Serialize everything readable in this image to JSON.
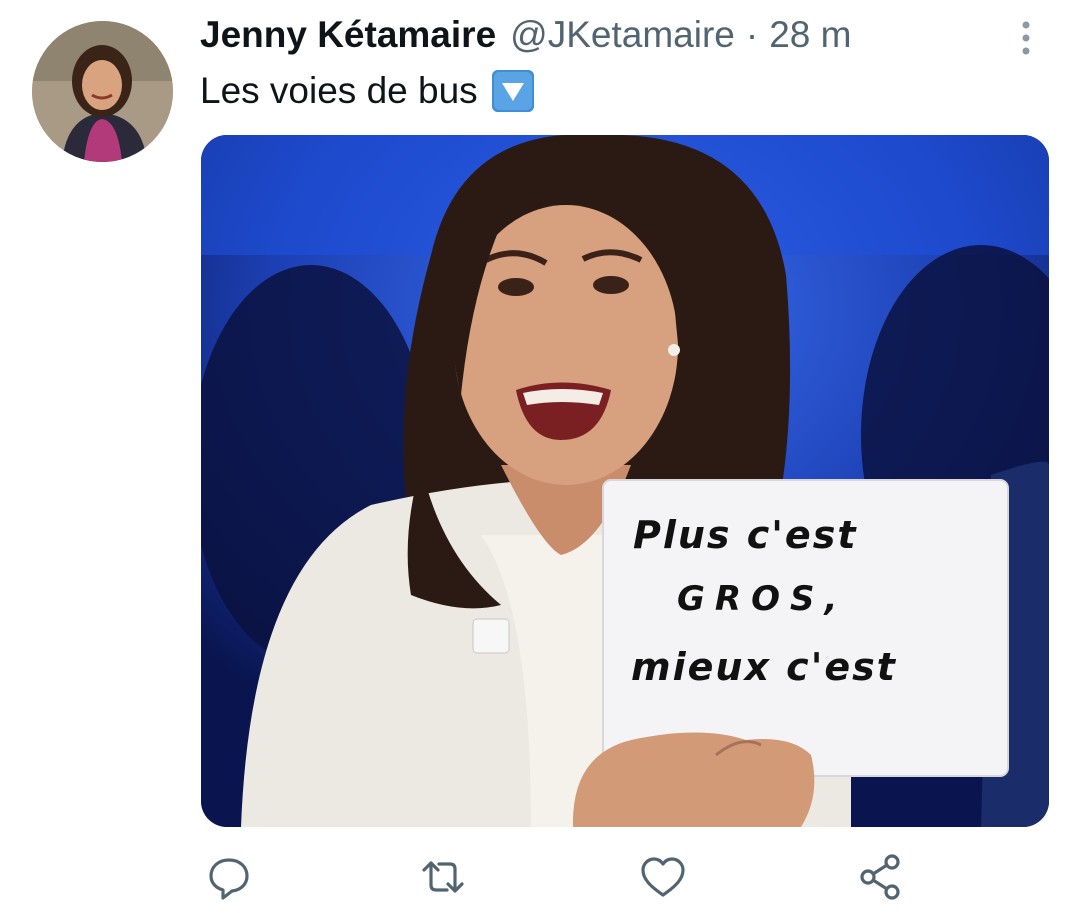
{
  "tweet": {
    "author_name": "Jenny Kétamaire",
    "handle": "@JKetamaire",
    "separator": "·",
    "time": "28 m",
    "text": "Les voies de bus",
    "emoji": "down-triangle-button-emoji"
  },
  "media": {
    "sign_lines": [
      "Plus c'est",
      "GROS,",
      "mieux c'est"
    ]
  },
  "actions": {
    "icons": [
      "reply-icon",
      "retweet-icon",
      "like-icon",
      "share-icon"
    ]
  },
  "colors": {
    "text": "#0f1419",
    "secondary": "#536471",
    "emoji_blue": "#3e8fd6",
    "stage_blue": "#1a3a9a"
  }
}
